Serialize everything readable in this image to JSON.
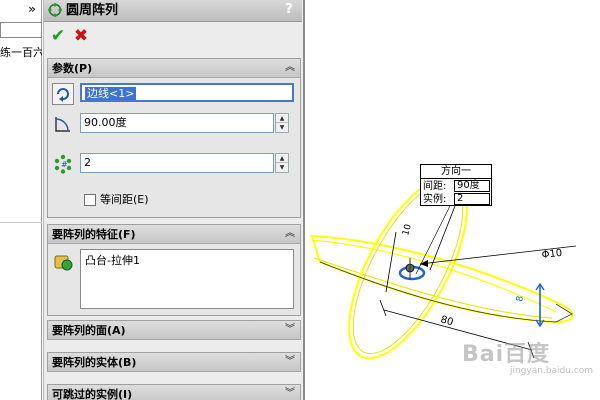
{
  "left_panel": {
    "collapse_glyph": "»",
    "tree_text": "练一百六"
  },
  "feature": {
    "title": "圆周阵列",
    "help_glyph": "?",
    "icon": "circular-pattern-icon"
  },
  "actions": {
    "ok_glyph": "✔",
    "cancel_glyph": "✖"
  },
  "parameters": {
    "header": "参数(P)",
    "direction_value": "边线<1>",
    "angle_value": "90.00度",
    "instances_value": "2",
    "equal_spacing_label": "等间距(E)",
    "equal_spacing_checked": false
  },
  "features_to_pattern": {
    "header": "要阵列的特征(F)",
    "items": [
      "凸台-拉伸1"
    ]
  },
  "faces_to_pattern": {
    "header": "要阵列的面(A)"
  },
  "bodies_to_pattern": {
    "header": "要阵列的实体(B)"
  },
  "instances_to_skip": {
    "header": "可跳过的实例(I)"
  },
  "callout": {
    "title": "方向一",
    "spacing_label": "间距:",
    "spacing_value": "90度",
    "instances_label": "实例:",
    "instances_value": "2"
  },
  "dimensions": {
    "diameter": "Φ10",
    "length": "80",
    "small_a": "10",
    "small_b": "8"
  },
  "watermark": {
    "text": "Bai百度",
    "sub": "jingyan.baidu.com"
  },
  "colors": {
    "highlight": "#ffff00",
    "selection": "#3b73d6",
    "ok": "#1e9b1e",
    "cancel": "#d01010"
  }
}
